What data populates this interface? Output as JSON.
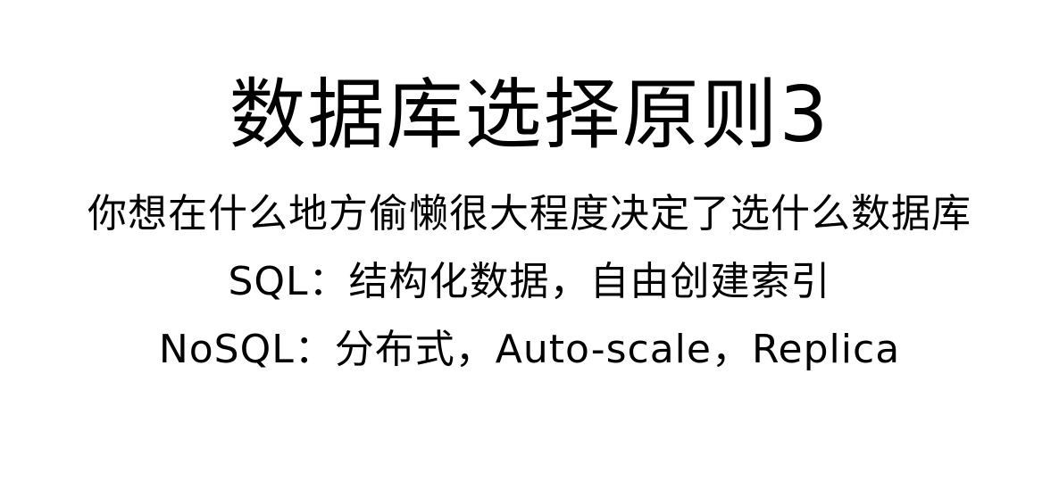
{
  "slide": {
    "title": "数据库选择原则3",
    "subtitle": "你想在什么地方偷懒很大程度决定了选什么数据库",
    "bullets": [
      "SQL：结构化数据，自由创建索引",
      "NoSQL：分布式，Auto-scale，Replica"
    ]
  },
  "colors": {
    "background": "#ffffff",
    "text": "#000000"
  }
}
